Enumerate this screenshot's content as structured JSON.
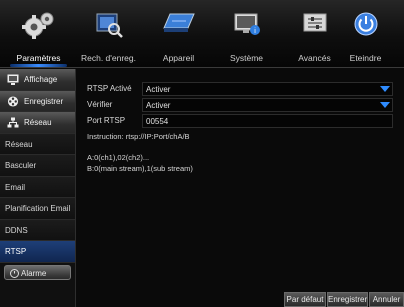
{
  "tabs": [
    {
      "label": "Paramètres",
      "icon": "gears-icon"
    },
    {
      "label": "Rech. d'enreg.",
      "icon": "search-record-icon"
    },
    {
      "label": "Appareil",
      "icon": "hard-disk-icon"
    },
    {
      "label": "Système",
      "icon": "monitor-info-icon"
    },
    {
      "label": "Avancés",
      "icon": "advanced-settings-icon"
    },
    {
      "label": "Eteindre",
      "icon": "power-icon"
    }
  ],
  "sidebar": {
    "items": [
      {
        "label": "Affichage",
        "kind": "group",
        "icon": "monitor-icon"
      },
      {
        "label": "Enregistrer",
        "kind": "group",
        "icon": "film-reel-icon"
      },
      {
        "label": "Réseau",
        "kind": "group",
        "icon": "network-icon"
      },
      {
        "label": "Réseau",
        "kind": "item"
      },
      {
        "label": "Basculer",
        "kind": "item"
      },
      {
        "label": "Email",
        "kind": "item"
      },
      {
        "label": "Planification Email",
        "kind": "item"
      },
      {
        "label": "DDNS",
        "kind": "item"
      },
      {
        "label": "RTSP",
        "kind": "item",
        "active": true
      },
      {
        "label": "Alarme",
        "kind": "group",
        "icon": "alarm-icon"
      }
    ]
  },
  "form": {
    "rtsp_enable": {
      "label": "RTSP Activé",
      "value": "Activer"
    },
    "verify": {
      "label": "Vérifier",
      "value": "Activer"
    },
    "port": {
      "label": "Port RTSP",
      "value": "00554"
    }
  },
  "instruction": "Instruction:  rtsp://IP:Port/chA/B",
  "notes": {
    "line1": "A:0(ch1),02(ch2)...",
    "line2": "B:0(main stream),1(sub stream)"
  },
  "buttons": {
    "default": "Par défaut",
    "save": "Enregistrer",
    "cancel": "Annuler"
  },
  "colors": {
    "accent": "#2f8cff",
    "selected": "#1e3f78"
  }
}
